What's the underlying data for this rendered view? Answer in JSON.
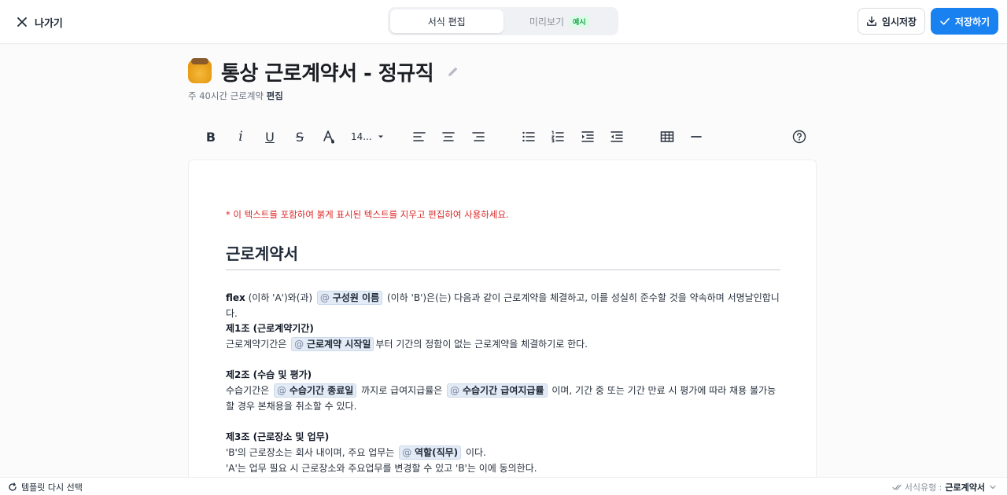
{
  "header": {
    "back_label": "나가기",
    "tabs": [
      {
        "label": "서식 편집",
        "active": true
      },
      {
        "label": "미리보기",
        "badge": "예시",
        "active": false
      }
    ],
    "temp_save_label": "임시저장",
    "save_label": "저장하기",
    "accent_color": "#1a82f0"
  },
  "document": {
    "title": "통상 근로계약서 - 정규직",
    "subtitle_prefix": "주 40시간 근로계약",
    "subtitle_bold": "편집"
  },
  "toolbar": {
    "bold": "B",
    "italic": "i",
    "underline": "U",
    "strike": "S",
    "font_size": "14...",
    "icons": [
      "bold-icon",
      "italic-icon",
      "underline-icon",
      "strikethrough-icon",
      "text-color-icon",
      "align-left-icon",
      "align-center-icon",
      "align-right-icon",
      "bullet-list-icon",
      "numbered-list-icon",
      "indent-icon",
      "outdent-icon",
      "table-icon",
      "horizontal-rule-icon",
      "help-icon"
    ]
  },
  "editor": {
    "warning": "* 이 텍스트를 포함하여 붉게 표시된 텍스트를 지우고 편집하여 사용하세요.",
    "heading": "근로계약서",
    "intro": {
      "bold_name": "flex",
      "t1": " (이하 'A')와(과) ",
      "chip1": "구성원 이름",
      "t2": " (이하 'B')은(는) 다음과 같이 근로계약을 체결하고, 이를 성실히 준수할 것을 약속하며 서명날인합니다."
    },
    "art1": {
      "title": "제1조 (근로계약기간)",
      "t1": "근로계약기간은 ",
      "chip1": "근로계약 시작일",
      "t2": "부터 기간의 정함이 없는 근로계약을 체결하기로 한다."
    },
    "art2": {
      "title": "제2조 (수습 및 평가)",
      "t1": "수습기간은 ",
      "chip1": "수습기간 종료일",
      "t2": " 까지로 급여지급률은 ",
      "chip2": "수습기간 급여지급률",
      "t3": " 이며, 기간 중 또는 기간 만료 시 평가에 따라 채용 불가능할 경우 본채용을 취소할 수 있다."
    },
    "art3": {
      "title": "제3조 (근로장소 및 업무)",
      "l1a": "'B'의 근로장소는 회사 내이며, 주요 업무는 ",
      "chip1": "역할(직무)",
      "l1b": " 이다.",
      "l2": "'A'는 업무 필요 시 근로장소와 주요업무를 변경할 수 있고 'B'는 이에 동의한다."
    },
    "chip_prefix": "@",
    "warning_color": "#dc2626"
  },
  "footer": {
    "reselect_label": "템플릿 다시 선택",
    "type_label": "서식유형 :",
    "type_value": "근로계약서"
  }
}
